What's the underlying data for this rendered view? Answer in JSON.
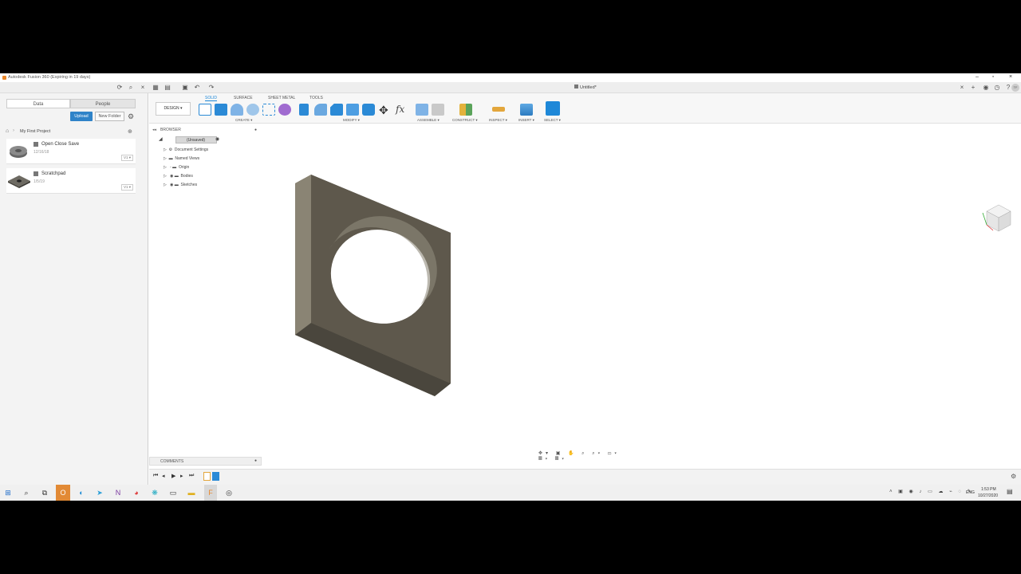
{
  "window": {
    "title": "Autodesk Fusion 360 (Expiring in 19 days)",
    "doc_tab": "Untitled*"
  },
  "data_panel": {
    "tabs": [
      "Data",
      "People"
    ],
    "upload_label": "Upload",
    "new_folder_label": "New Folder",
    "breadcrumb": "My First Project",
    "items": [
      {
        "name": "Open Close Save",
        "date": "12/16/18",
        "version": "V1 ▾"
      },
      {
        "name": "Scratchpad",
        "date": "1/5/19",
        "version": "V1 ▾"
      }
    ]
  },
  "toolbar": {
    "workspace_tabs": [
      "SOLID",
      "SURFACE",
      "SHEET METAL",
      "TOOLS"
    ],
    "design_label": "DESIGN ▾",
    "groups": [
      "CREATE ▾",
      "MODIFY ▾",
      "ASSEMBLE ▾",
      "CONSTRUCT ▾",
      "INSPECT ▾",
      "INSERT ▾",
      "SELECT ▾"
    ]
  },
  "browser": {
    "header": "BROWSER",
    "root": "(Unsaved)",
    "items": [
      "Document Settings",
      "Named Views",
      "Origin",
      "Bodies",
      "Sketches"
    ]
  },
  "comments": {
    "label": "COMMENTS"
  },
  "taskbar": {
    "lang": "ENG",
    "time": "1:53 PM",
    "date": "10/27/2020"
  },
  "colors": {
    "accent": "#1e88d8",
    "body_face": "#5c574c",
    "body_side": "#7a7466",
    "upload_btn": "#2f83c8"
  }
}
